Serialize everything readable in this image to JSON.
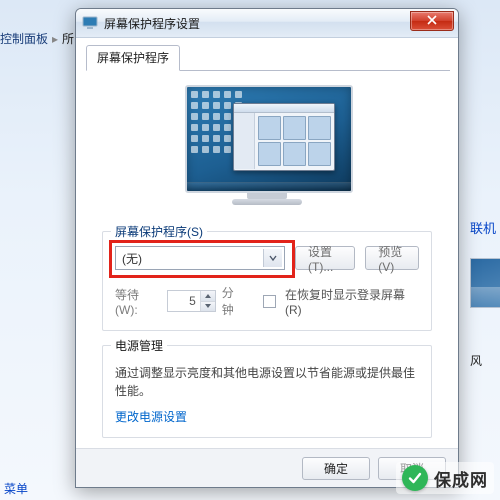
{
  "breadcrumb": {
    "control_panel": "控制面板",
    "next": "所"
  },
  "left_bottom_link": "菜单",
  "dialog": {
    "title": "屏幕保护程序设置",
    "tab_label": "屏幕保护程序",
    "group_saver_title": "屏幕保护程序(S)",
    "combo_value": "(无)",
    "btn_settings": "设置(T)...",
    "btn_preview": "预览(V)",
    "wait_label": "等待(W):",
    "wait_value": "5",
    "wait_unit": "分钟",
    "resume_checkbox": "在恢复时显示登录屏幕(R)",
    "group_power_title": "电源管理",
    "power_desc": "通过调整显示亮度和其他电源设置以节省能源或提供最佳性能。",
    "power_link": "更改电源设置",
    "btn_ok": "确定",
    "btn_cancel": "取消"
  },
  "right": {
    "link1": "联机",
    "label2": "风"
  },
  "watermark": {
    "text": "保成网"
  },
  "colors": {
    "highlight": "#e2231a",
    "link": "#0066cc"
  }
}
